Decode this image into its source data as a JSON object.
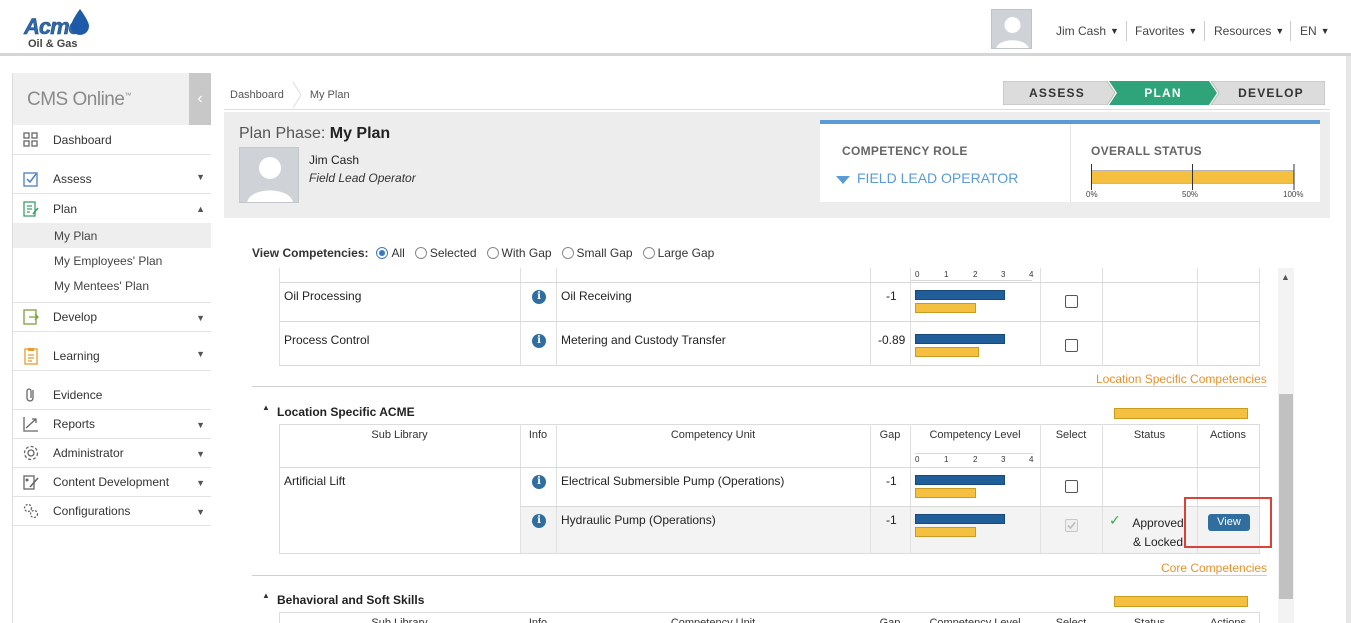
{
  "header": {
    "logo_word": "Acme",
    "logo_sub": "Oil & Gas",
    "user": "Jim Cash",
    "favorites": "Favorites",
    "resources": "Resources",
    "language": "EN"
  },
  "sidebar": {
    "title": "CMS Online",
    "title_tm": "™",
    "collapse_glyph": "‹",
    "items": [
      {
        "label": "Dashboard"
      },
      {
        "label": "Assess"
      },
      {
        "label": "Plan"
      },
      {
        "label": "Develop"
      },
      {
        "label": "Learning"
      },
      {
        "label": "Evidence"
      },
      {
        "label": "Reports"
      },
      {
        "label": "Administrator"
      },
      {
        "label": "Content Development"
      },
      {
        "label": "Configurations"
      }
    ],
    "plan_sub": [
      "My Plan",
      "My Employees' Plan",
      "My Mentees' Plan"
    ]
  },
  "breadcrumb": [
    "Dashboard",
    "My Plan"
  ],
  "phases": {
    "assess": "ASSESS",
    "plan": "PLAN",
    "develop": "DEVELOP",
    "active_color": "#2fa37a"
  },
  "plan": {
    "phase_label": "Plan Phase:",
    "phase_name": "My Plan",
    "user_name": "Jim Cash",
    "user_role": "Field Lead Operator"
  },
  "role_card": {
    "role_label": "COMPETENCY ROLE",
    "role_value": "FIELD LEAD OPERATOR",
    "status_label": "OVERALL STATUS",
    "ticks": [
      "0%",
      "50%",
      "100%"
    ]
  },
  "view_competencies": {
    "label": "View Competencies:",
    "options": [
      "All",
      "Selected",
      "With Gap",
      "Small Gap",
      "Large Gap"
    ],
    "selected": "All"
  },
  "scale_ticks": [
    "0",
    "1",
    "2",
    "3",
    "4"
  ],
  "table_headers": {
    "sub_library": "Sub Library",
    "info": "Info",
    "competency_unit": "Competency Unit",
    "gap": "Gap",
    "competency_level": "Competency Level",
    "select": "Select",
    "status": "Status",
    "actions": "Actions"
  },
  "top_rows": [
    {
      "sub_library": "Oil Processing",
      "unit": "Oil Receiving",
      "gap": "-1"
    },
    {
      "sub_library": "Process Control",
      "unit": "Metering and Custody Transfer",
      "gap": "-0.89"
    }
  ],
  "sections": [
    {
      "title": "Location Specific ACME",
      "link": "Location Specific Competencies"
    },
    {
      "title": "Behavioral and Soft Skills",
      "link": "Core Competencies"
    }
  ],
  "location_rows": [
    {
      "sub_library": "Artificial Lift",
      "unit": "Electrical Submersible Pump (Operations)",
      "gap": "-1"
    },
    {
      "sub_library": "",
      "unit": "Hydraulic Pump (Operations)",
      "gap": "-1",
      "status": "Approved & Locked",
      "action": "View"
    }
  ],
  "info_glyph": "i",
  "check_glyph": "✓",
  "scroll_up_glyph": "▲",
  "section_tri_glyph": "▲",
  "caret_glyph": "▾"
}
